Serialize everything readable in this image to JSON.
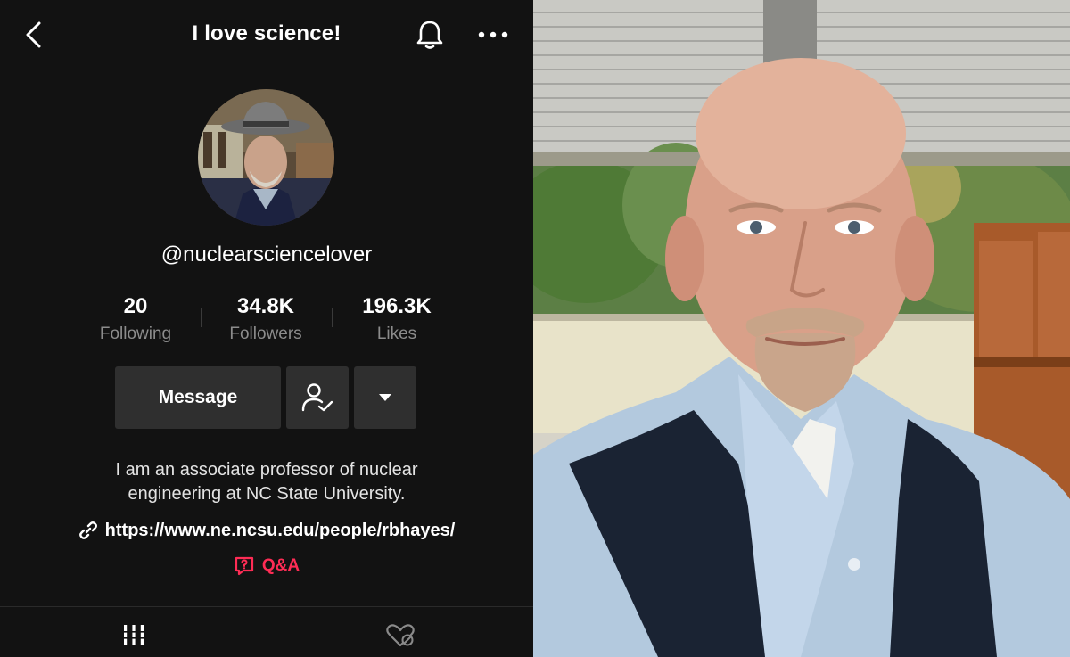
{
  "header": {
    "title": "I love science!",
    "back_icon": "chevron-left-icon",
    "bell_icon": "bell-icon",
    "more_icon": "more-horizontal-icon"
  },
  "profile": {
    "username": "@nuclearsciencelover",
    "stats": [
      {
        "value": "20",
        "label": "Following"
      },
      {
        "value": "34.8K",
        "label": "Followers"
      },
      {
        "value": "196.3K",
        "label": "Likes"
      }
    ],
    "buttons": {
      "message_label": "Message",
      "follow_icon": "user-check-icon",
      "dropdown_icon": "caret-down-icon"
    },
    "bio_lines": [
      "I am an associate professor of nuclear",
      "engineering at NC State University."
    ],
    "link": {
      "icon": "link-icon",
      "text": "https://www.ne.ncsu.edu/people/rbhayes/"
    },
    "qa": {
      "icon": "question-bubble-icon",
      "text": "Q&A"
    }
  },
  "tabs": [
    {
      "icon": "grid-icon",
      "name": "videos"
    },
    {
      "icon": "heart-hidden-icon",
      "name": "liked"
    }
  ],
  "colors": {
    "background": "#121212",
    "button": "#2f2f2f",
    "muted_text": "#8c8c8c",
    "accent_red": "#fe2c55"
  }
}
